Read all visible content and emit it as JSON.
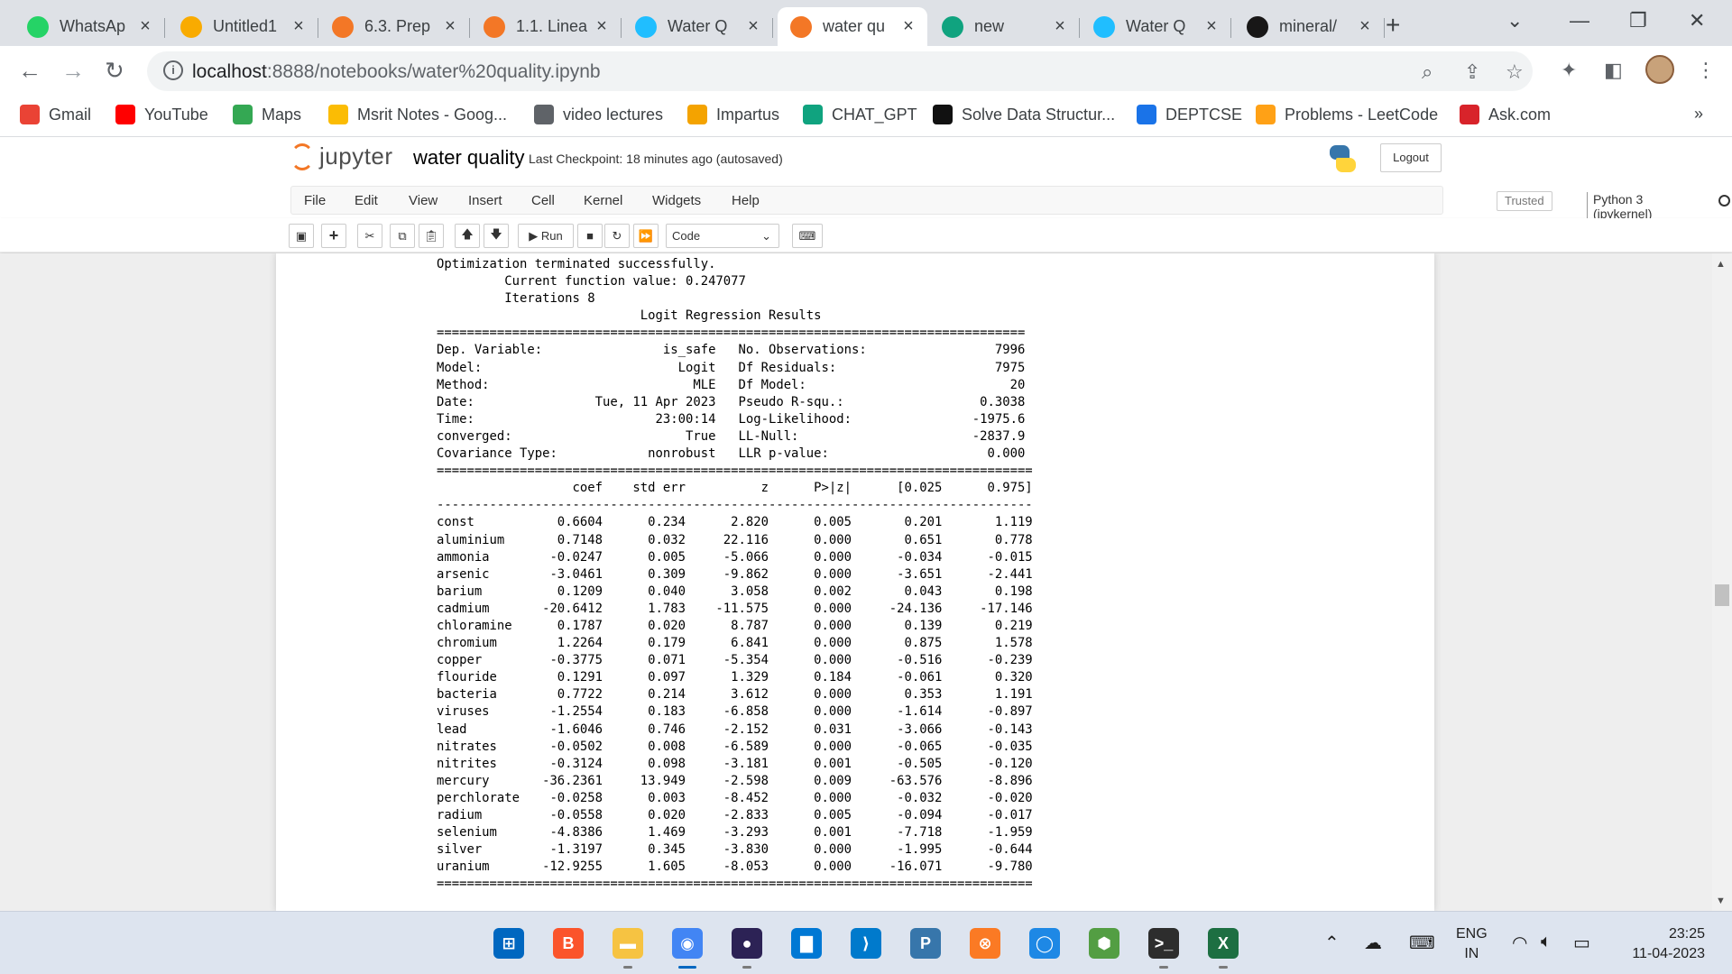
{
  "browser": {
    "tabs": [
      {
        "title": "WhatsAp",
        "icon": "whatsapp-icon",
        "color": "#25d366"
      },
      {
        "title": "Untitled1",
        "icon": "colab-icon",
        "color": "#f9ab00"
      },
      {
        "title": "6.3. Prep",
        "icon": "notebook-icon",
        "color": "#f37726"
      },
      {
        "title": "1.1. Linea",
        "icon": "notebook-icon",
        "color": "#f37726"
      },
      {
        "title": "Water Q",
        "icon": "kaggle-icon",
        "color": "#20beff"
      },
      {
        "title": "water qu",
        "icon": "jupyter-icon",
        "color": "#f37726",
        "active": true
      },
      {
        "title": "new",
        "icon": "openai-icon",
        "color": "#10a37f"
      },
      {
        "title": "Water Q",
        "icon": "kaggle-icon",
        "color": "#20beff"
      },
      {
        "title": "mineral/",
        "icon": "github-icon",
        "color": "#181717"
      }
    ],
    "url_host": "localhost",
    "url_rest": ":8888/notebooks/water%20quality.ipynb",
    "bookmarks": [
      {
        "label": "Gmail",
        "icon": "gmail-icon",
        "color": "#ea4335"
      },
      {
        "label": "YouTube",
        "icon": "youtube-icon",
        "color": "#ff0000"
      },
      {
        "label": "Maps",
        "icon": "maps-icon",
        "color": "#34a853"
      },
      {
        "label": "Msrit Notes - Goog...",
        "icon": "google-drive-icon",
        "color": "#fbbc04"
      },
      {
        "label": "video lectures",
        "icon": "globe-icon",
        "color": "#5f6368"
      },
      {
        "label": "Impartus",
        "icon": "impartus-icon",
        "color": "#f4a300"
      },
      {
        "label": "CHAT_GPT",
        "icon": "openai-icon",
        "color": "#10a37f"
      },
      {
        "label": "Solve Data Structur...",
        "icon": "hackerrank-icon",
        "color": "#111111"
      },
      {
        "label": "DEPTCSE",
        "icon": "dept-icon",
        "color": "#1a73e8"
      },
      {
        "label": "Problems - LeetCode",
        "icon": "leetcode-icon",
        "color": "#ffa116"
      },
      {
        "label": "Ask.com",
        "icon": "ask-icon",
        "color": "#d8232a"
      }
    ],
    "more_bookmarks": "»"
  },
  "jupyter": {
    "logo_text": "jupyter",
    "notebook_name": "water quality",
    "checkpoint": "Last Checkpoint: 18 minutes ago",
    "autosaved": "(autosaved)",
    "logout": "Logout",
    "menu": [
      "File",
      "Edit",
      "View",
      "Insert",
      "Cell",
      "Kernel",
      "Widgets",
      "Help"
    ],
    "trusted": "Trusted",
    "kernel": "Python 3 (ipykernel)",
    "run_label": "Run",
    "cell_type": "Code"
  },
  "output_lines": [
    "Optimization terminated successfully.",
    "         Current function value: 0.247077",
    "         Iterations 8",
    "                           Logit Regression Results                           ",
    "==============================================================================",
    "Dep. Variable:                is_safe   No. Observations:                 7996",
    "Model:                          Logit   Df Residuals:                     7975",
    "Method:                           MLE   Df Model:                           20",
    "Date:                Tue, 11 Apr 2023   Pseudo R-squ.:                  0.3038",
    "Time:                        23:00:14   Log-Likelihood:                -1975.6",
    "converged:                       True   LL-Null:                       -2837.9",
    "Covariance Type:            nonrobust   LLR p-value:                     0.000",
    "===============================================================================",
    "                  coef    std err          z      P>|z|      [0.025      0.975]",
    "-------------------------------------------------------------------------------",
    "const           0.6604      0.234      2.820      0.005       0.201       1.119",
    "aluminium       0.7148      0.032     22.116      0.000       0.651       0.778",
    "ammonia        -0.0247      0.005     -5.066      0.000      -0.034      -0.015",
    "arsenic        -3.0461      0.309     -9.862      0.000      -3.651      -2.441",
    "barium          0.1209      0.040      3.058      0.002       0.043       0.198",
    "cadmium       -20.6412      1.783    -11.575      0.000     -24.136     -17.146",
    "chloramine      0.1787      0.020      8.787      0.000       0.139       0.219",
    "chromium        1.2264      0.179      6.841      0.000       0.875       1.578",
    "copper         -0.3775      0.071     -5.354      0.000      -0.516      -0.239",
    "flouride        0.1291      0.097      1.329      0.184      -0.061       0.320",
    "bacteria        0.7722      0.214      3.612      0.000       0.353       1.191",
    "viruses        -1.2554      0.183     -6.858      0.000      -1.614      -0.897",
    "lead           -1.6046      0.746     -2.152      0.031      -3.066      -0.143",
    "nitrates       -0.0502      0.008     -6.589      0.000      -0.065      -0.035",
    "nitrites       -0.3124      0.098     -3.181      0.001      -0.505      -0.120",
    "mercury       -36.2361     13.949     -2.598      0.009     -63.576      -8.896",
    "perchlorate    -0.0258      0.003     -8.452      0.000      -0.032      -0.020",
    "radium         -0.0558      0.020     -2.833      0.005      -0.094      -0.017",
    "selenium       -4.8386      1.469     -3.293      0.001      -7.718      -1.959",
    "silver         -1.3197      0.345     -3.830      0.000      -1.995      -0.644",
    "uranium       -12.9255      1.605     -8.053      0.000     -16.071      -9.780",
    "==============================================================================="
  ],
  "taskbar": {
    "apps": [
      {
        "name": "windows-start-icon",
        "color": "#0067c0",
        "glyph": "⊞"
      },
      {
        "name": "brave-icon",
        "color": "#fb542b",
        "glyph": "B"
      },
      {
        "name": "file-explorer-icon",
        "color": "#f6c342",
        "glyph": "▬"
      },
      {
        "name": "chrome-icon",
        "color": "#4285f4",
        "glyph": "◉",
        "active": true
      },
      {
        "name": "eclipse-icon",
        "color": "#2c2255",
        "glyph": "●"
      },
      {
        "name": "desktop-app-icon",
        "color": "#0078d4",
        "glyph": "▇"
      },
      {
        "name": "vscode-icon",
        "color": "#007acc",
        "glyph": "⟩"
      },
      {
        "name": "python-idle-icon",
        "color": "#3776ab",
        "glyph": "P"
      },
      {
        "name": "xampp-icon",
        "color": "#fb7a24",
        "glyph": "⊗"
      },
      {
        "name": "circle-app-icon",
        "color": "#1e88e5",
        "glyph": "◯"
      },
      {
        "name": "nodejs-icon",
        "color": "#539e43",
        "glyph": "⬢"
      },
      {
        "name": "terminal-icon",
        "color": "#2d2d2d",
        "glyph": ">_"
      },
      {
        "name": "excel-icon",
        "color": "#1d6f42",
        "glyph": "X"
      }
    ],
    "lang_top": "ENG",
    "lang_bottom": "IN",
    "time": "23:25",
    "date": "11-04-2023"
  }
}
